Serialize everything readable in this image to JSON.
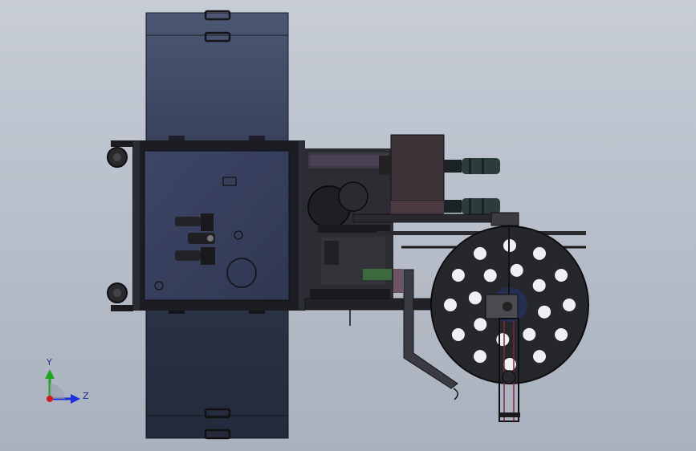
{
  "view": {
    "background_top": "#c7ccd6",
    "background_bottom": "#a9b1be"
  },
  "triad": {
    "y_label": "Y",
    "z_label": "Z",
    "y_color": "#1ea51e",
    "z_color": "#1d2fd6",
    "origin_color": "#d11c1c"
  },
  "model": {
    "cabinet_color": "#3e4a66",
    "frame_color": "#1a1c20",
    "disc_color": "#26272b",
    "motor_box_color": "#3c3438",
    "disc_hole_count": 20
  }
}
